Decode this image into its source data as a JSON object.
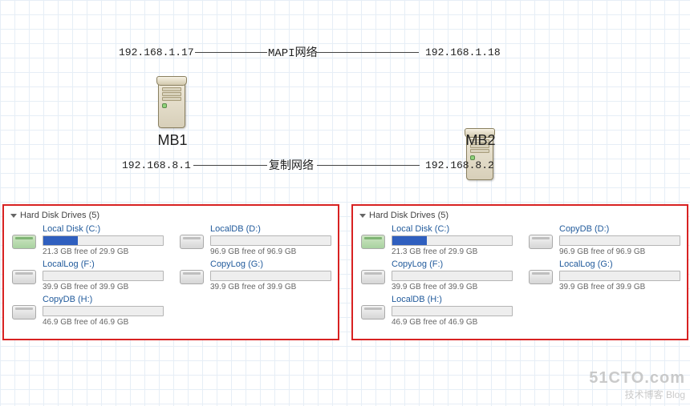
{
  "network": {
    "top_label": "MAPI网络",
    "bottom_label": "复制网络",
    "left_top_ip": "192.168.1.17",
    "right_top_ip": "192.168.1.18",
    "left_bottom_ip": "192.168.8.1",
    "right_bottom_ip": "192.168.8.2"
  },
  "servers": {
    "left_name": "MB1",
    "right_name": "MB2"
  },
  "panels": {
    "header": "Hard Disk Drives (5)",
    "left": {
      "drives": [
        {
          "name": "Local Disk (C:)",
          "sub": "21.3 GB free of 29.9 GB",
          "fill_pct": 29,
          "sys": true
        },
        {
          "name": "LocalDB (D:)",
          "sub": "96.9 GB free of 96.9 GB",
          "fill_pct": 0
        },
        {
          "name": "LocalLog (F:)",
          "sub": "39.9 GB free of 39.9 GB",
          "fill_pct": 0
        },
        {
          "name": "CopyLog (G:)",
          "sub": "39.9 GB free of 39.9 GB",
          "fill_pct": 0
        },
        {
          "name": "CopyDB (H:)",
          "sub": "46.9 GB free of 46.9 GB",
          "fill_pct": 0
        }
      ]
    },
    "right": {
      "drives": [
        {
          "name": "Local Disk (C:)",
          "sub": "21.3 GB free of 29.9 GB",
          "fill_pct": 29,
          "sys": true
        },
        {
          "name": "CopyDB (D:)",
          "sub": "96.9 GB free of 96.9 GB",
          "fill_pct": 0
        },
        {
          "name": "CopyLog (F:)",
          "sub": "39.9 GB free of 39.9 GB",
          "fill_pct": 0
        },
        {
          "name": "LocalLog (G:)",
          "sub": "39.9 GB free of 39.9 GB",
          "fill_pct": 0
        },
        {
          "name": "LocalDB (H:)",
          "sub": "46.9 GB free of 46.9 GB",
          "fill_pct": 0
        }
      ]
    }
  },
  "watermark": {
    "line1": "51CTO.com",
    "line2": "技术博客    Blog"
  }
}
